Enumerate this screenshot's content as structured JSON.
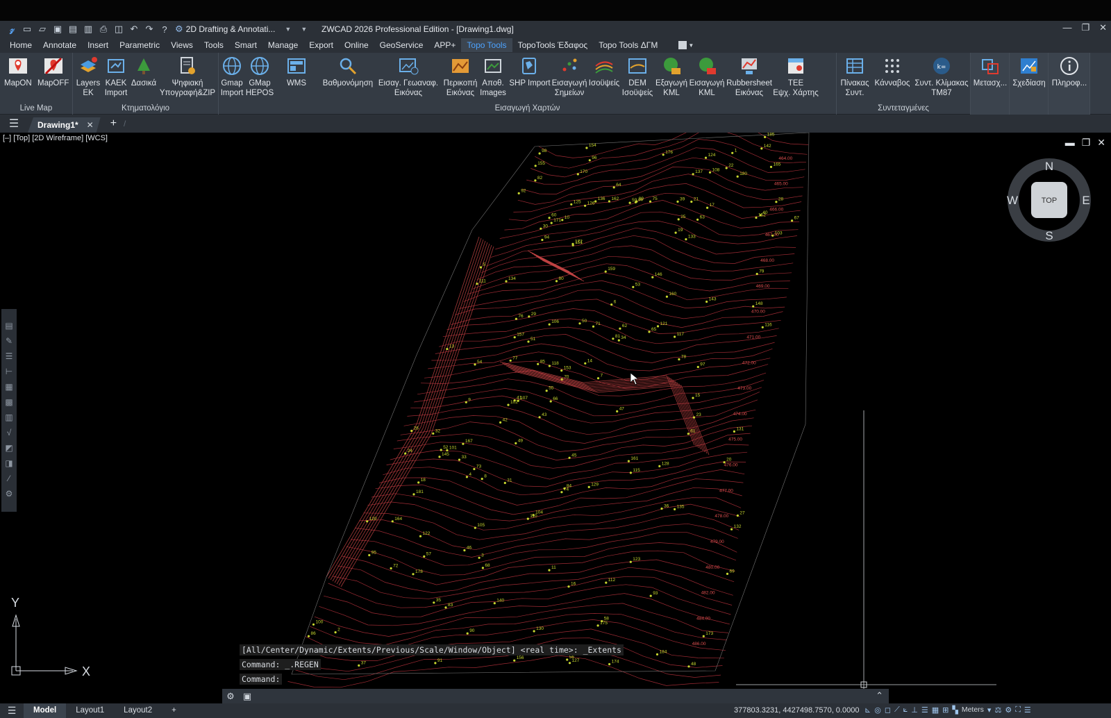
{
  "app": {
    "window_title": "ZWCAD 2026 Professional Edition - [Drawing1.dwg]",
    "workspace": "2D Drafting & Annotati...",
    "quick_access_icons": [
      "app-logo-icon",
      "new-icon",
      "open-icon",
      "save-icon",
      "save-as-icon",
      "print-preview-icon",
      "print-icon",
      "plot-icon",
      "undo-icon",
      "redo-icon",
      "help-icon"
    ]
  },
  "menu": {
    "items": [
      "Home",
      "Annotate",
      "Insert",
      "Parametric",
      "Views",
      "Tools",
      "Smart",
      "Manage",
      "Export",
      "Online",
      "GeoService",
      "APP+",
      "Topo Tools",
      "TopoTools Έδαφος",
      "Topo Tools ΔΓΜ"
    ],
    "active": "Topo Tools"
  },
  "ribbon": {
    "groups": [
      {
        "title": "Live Map",
        "buttons": [
          {
            "label": "MapON"
          },
          {
            "label": "MapOFF"
          }
        ]
      },
      {
        "title": "Κτηματολόγιο",
        "buttons": [
          {
            "label": "Layers\nΕΚ"
          },
          {
            "label": "KAEK\nImport"
          },
          {
            "label": "Δασικά"
          },
          {
            "label": "Ψηφιακή\nΥπογραφή&ZIP"
          }
        ]
      },
      {
        "title": "Εισαγωγή Χαρτών",
        "buttons": [
          {
            "label": "Gmap\nImport"
          },
          {
            "label": "GMap\nHEPOS"
          },
          {
            "label": "WMS"
          },
          {
            "label": "Βαθμονόμηση"
          },
          {
            "label": "Εισαγ. Γεωαναφ.\nΕικόνας"
          },
          {
            "label": "Περικοπή\nΕικόνας"
          },
          {
            "label": "Αποθ.\nImages"
          },
          {
            "label": "SHP Import"
          },
          {
            "label": "Εισαγωγή\nΣημείων"
          },
          {
            "label": "Ισοϋψείς"
          },
          {
            "label": "DEM\nΙσοϋψείς"
          },
          {
            "label": "Εξαγωγή\nKML"
          },
          {
            "label": "Εισαγωγή\nKML"
          },
          {
            "label": "Rubbersheet\nΕικόνας"
          },
          {
            "label": "TEE\nΕψχ. Χάρτης"
          }
        ]
      },
      {
        "title": "Συντεταγμένες",
        "buttons": [
          {
            "label": "Πίνακας\nΣυντ."
          },
          {
            "label": "Κάνναβος"
          },
          {
            "label": "Συντ. Κλίμακας\nTM87"
          }
        ]
      },
      {
        "title": "",
        "buttons": [
          {
            "label": "Μετασχ..."
          }
        ]
      },
      {
        "title": "",
        "buttons": [
          {
            "label": "Σχεδίαση"
          }
        ]
      },
      {
        "title": "",
        "buttons": [
          {
            "label": "Πληροφ..."
          }
        ]
      }
    ]
  },
  "document_tab": {
    "name": "Drawing1*",
    "close": "✕",
    "add": "+"
  },
  "viewport": {
    "label": "[–] [Top] [2D Wireframe] [WCS]",
    "viewcube": {
      "center": "TOP",
      "n": "N",
      "s": "S",
      "e": "E",
      "w": "W"
    },
    "ucs": {
      "x": "X",
      "y": "Y"
    }
  },
  "drawing": {
    "contour_color": "#b0303a",
    "point_color": "#c8d830",
    "point_labels": [
      "121",
      "122",
      "120",
      "123",
      "124",
      "125",
      "126",
      "127",
      "128",
      "129",
      "130",
      "131",
      "132",
      "133",
      "134",
      "135",
      "136",
      "137",
      "140",
      "142",
      "143",
      "145",
      "146",
      "148",
      "151",
      "152",
      "153",
      "154",
      "155",
      "156",
      "157",
      "159",
      "160",
      "161",
      "162",
      "164",
      "165",
      "166",
      "167",
      "170",
      "171",
      "172",
      "173",
      "174",
      "175",
      "176",
      "178",
      "180",
      "181",
      "184",
      "185",
      "94",
      "95",
      "96",
      "100",
      "101",
      "102",
      "103",
      "104",
      "105",
      "106",
      "107",
      "108",
      "110",
      "111",
      "112",
      "115",
      "116",
      "117",
      "118",
      "99",
      "98",
      "97",
      "93",
      "92",
      "91",
      "90",
      "86",
      "85",
      "84",
      "83",
      "82",
      "81",
      "80",
      "79",
      "78",
      "77",
      "76",
      "75",
      "74",
      "73",
      "72",
      "71",
      "70",
      "69",
      "68",
      "67",
      "66",
      "65",
      "64",
      "63",
      "62",
      "61",
      "60",
      "59",
      "58",
      "57",
      "56",
      "55",
      "54",
      "53",
      "52",
      "51",
      "50",
      "49",
      "48",
      "47",
      "46",
      "45",
      "44",
      "43",
      "42",
      "41",
      "40",
      "39",
      "38",
      "37",
      "36",
      "35",
      "34",
      "33",
      "32",
      "31",
      "30",
      "29",
      "28",
      "27",
      "26",
      "25",
      "24",
      "23",
      "22",
      "21",
      "20",
      "19",
      "18",
      "17",
      "16",
      "15",
      "14",
      "13",
      "12",
      "11",
      "10",
      "9",
      "8",
      "7",
      "6",
      "5",
      "4",
      "3",
      "2",
      "1"
    ],
    "contour_labels": [
      "464.00",
      "465.00",
      "466.00",
      "467.00",
      "468.00",
      "469.00",
      "470.00",
      "471.00",
      "472.00",
      "473.00",
      "474.00",
      "475.00",
      "476.00",
      "477.00",
      "478.00",
      "479.00",
      "480.00",
      "482.00",
      "484.00",
      "486.00"
    ]
  },
  "command": {
    "history": [
      "[All/Center/Dynamic/Extents/Previous/Scale/Window/Object] <real time>: _Extents",
      "Command: _.REGEN",
      "Command:"
    ]
  },
  "status": {
    "layouts": [
      "Model",
      "Layout1",
      "Layout2",
      "+"
    ],
    "active_layout": "Model",
    "coordinates": "377803.3231, 4427498.7570, 0.0000",
    "units": "Meters"
  },
  "colors": {
    "chrome_dark": "#2b3037",
    "ribbon_bg": "#343b44",
    "accent": "#4da3ff",
    "canvas": "#000000"
  }
}
